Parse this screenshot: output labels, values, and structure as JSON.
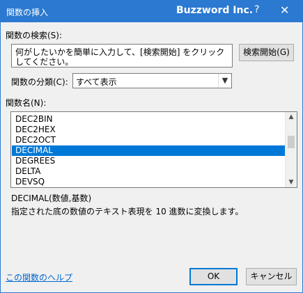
{
  "title_bar": {
    "title": "関数の挿入",
    "brand": "Buzzword Inc.",
    "help": "?",
    "close": "✕"
  },
  "search": {
    "label": "関数の検索(S):",
    "value": "何がしたいかを簡単に入力して、[検索開始] をクリックしてください。",
    "button": "検索開始(G)"
  },
  "category": {
    "label": "関数の分類(C):",
    "selected": "すべて表示"
  },
  "function_list": {
    "label": "関数名(N):",
    "items": [
      "DEC2BIN",
      "DEC2HEX",
      "DEC2OCT",
      "DECIMAL",
      "DEGREES",
      "DELTA",
      "DEVSQ"
    ],
    "selected_index": 3
  },
  "description": {
    "syntax": "DECIMAL(数値,基数)",
    "text": "指定された底の数値のテキスト表現を 10 進数に変換します。"
  },
  "footer": {
    "help_link": "この関数のヘルプ",
    "ok": "OK",
    "cancel": "キャンセル"
  },
  "colors": {
    "title_bar": "#2b79d0",
    "selection": "#0078d7",
    "link": "#0066cc"
  }
}
